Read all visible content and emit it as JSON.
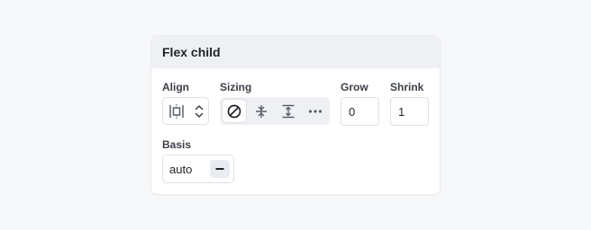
{
  "panel": {
    "title": "Flex child"
  },
  "align": {
    "label": "Align",
    "icon": "align-distribute-icon",
    "stepper_icon": "chevron-up-down-icon"
  },
  "sizing": {
    "label": "Sizing",
    "options": [
      {
        "icon": "no-sizing-icon",
        "selected": true
      },
      {
        "icon": "shrink-vertical-icon",
        "selected": false
      },
      {
        "icon": "grow-vertical-icon",
        "selected": false
      },
      {
        "icon": "more-options-icon",
        "selected": false
      }
    ]
  },
  "grow": {
    "label": "Grow",
    "value": "0"
  },
  "shrink": {
    "label": "Shrink",
    "value": "1"
  },
  "basis": {
    "label": "Basis",
    "value": "auto",
    "reset_icon": "minus-icon"
  },
  "colors": {
    "background": "#f7f8fa",
    "header_bg": "#eef0f3",
    "border": "#dde0e5",
    "icon": "#5a606b"
  }
}
